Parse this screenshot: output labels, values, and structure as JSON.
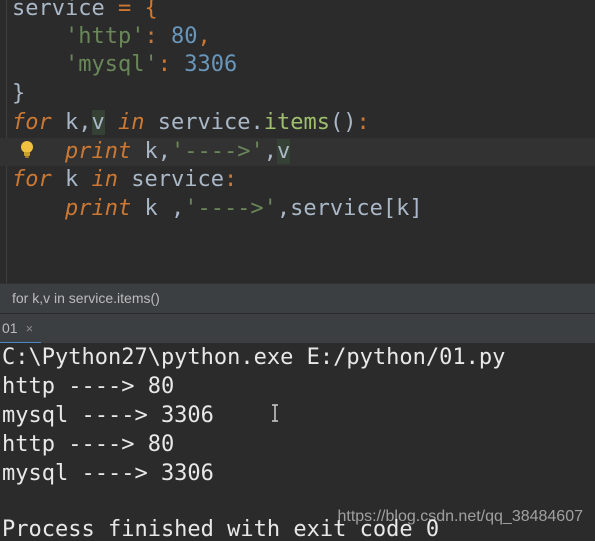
{
  "editor": {
    "lines": [
      {
        "t1": "service",
        "t2": " = {"
      },
      {
        "indent": "    ",
        "key": "'http'",
        "colon": ": ",
        "val": "80",
        "tail": ","
      },
      {
        "indent": "    ",
        "key": "'mysql'",
        "colon": ": ",
        "val": "3306",
        "tail": ""
      },
      {
        "text": "}"
      },
      {
        "kw1": "for",
        "a": " k,",
        "v": "v",
        "sp": " ",
        "kw2": "in",
        "b": " service.",
        "method": "items",
        "c": "()",
        "colon": ":"
      },
      {
        "indent": "    ",
        "kw": "print",
        "a": " k,",
        "str": "'---->'",
        "b": ",",
        "v": "v"
      },
      {
        "kw1": "for",
        "a": " k ",
        "kw2": "in",
        "b": " service",
        "colon": ":"
      },
      {
        "indent": "    ",
        "kw": "print",
        "a": " k ,",
        "str": "'---->'",
        "b": ",service[k]"
      }
    ],
    "bulb_icon": "lightbulb-icon"
  },
  "breadcrumb": "for k,v in service.items()",
  "run_tab": {
    "label": "01",
    "close": "×"
  },
  "console": {
    "lines": [
      "C:\\Python27\\python.exe E:/python/01.py",
      "http ----> 80",
      "mysql ----> 3306",
      "http ----> 80",
      "mysql ----> 3306",
      "",
      "Process finished with exit code 0"
    ]
  },
  "watermark": "https://blog.csdn.net/qq_38484607",
  "colors": {
    "keyword": "#cc7832",
    "string": "#6a8759",
    "number": "#6897bb",
    "text": "#a9b7c6",
    "background": "#2b2b2b"
  }
}
